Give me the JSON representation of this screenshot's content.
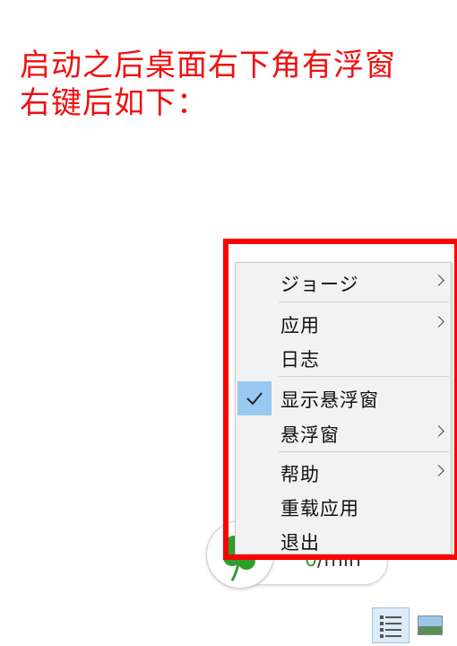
{
  "headline": {
    "line1": "启动之后桌面右下角有浮窗",
    "line2": "右键后如下："
  },
  "widget": {
    "rate_value": "0",
    "rate_unit": "/min"
  },
  "context_menu": {
    "items": [
      {
        "label": "ジョージ",
        "submenu": true
      },
      {
        "label": "应用",
        "submenu": true
      },
      {
        "label": "日志",
        "submenu": false
      },
      {
        "label": "显示悬浮窗",
        "submenu": false,
        "checked": true
      },
      {
        "label": "悬浮窗",
        "submenu": true
      },
      {
        "label": "帮助",
        "submenu": true
      },
      {
        "label": "重载应用",
        "submenu": false
      },
      {
        "label": "退出",
        "submenu": false
      }
    ]
  },
  "colors": {
    "annotation_red": "#ff0000",
    "check_highlight": "#99c9f0",
    "clover_green": "#2e9e2e"
  },
  "icons": {
    "widget": "clover-icon",
    "check": "checkmark-icon",
    "tray": [
      "list-view-icon",
      "image-icon"
    ]
  }
}
